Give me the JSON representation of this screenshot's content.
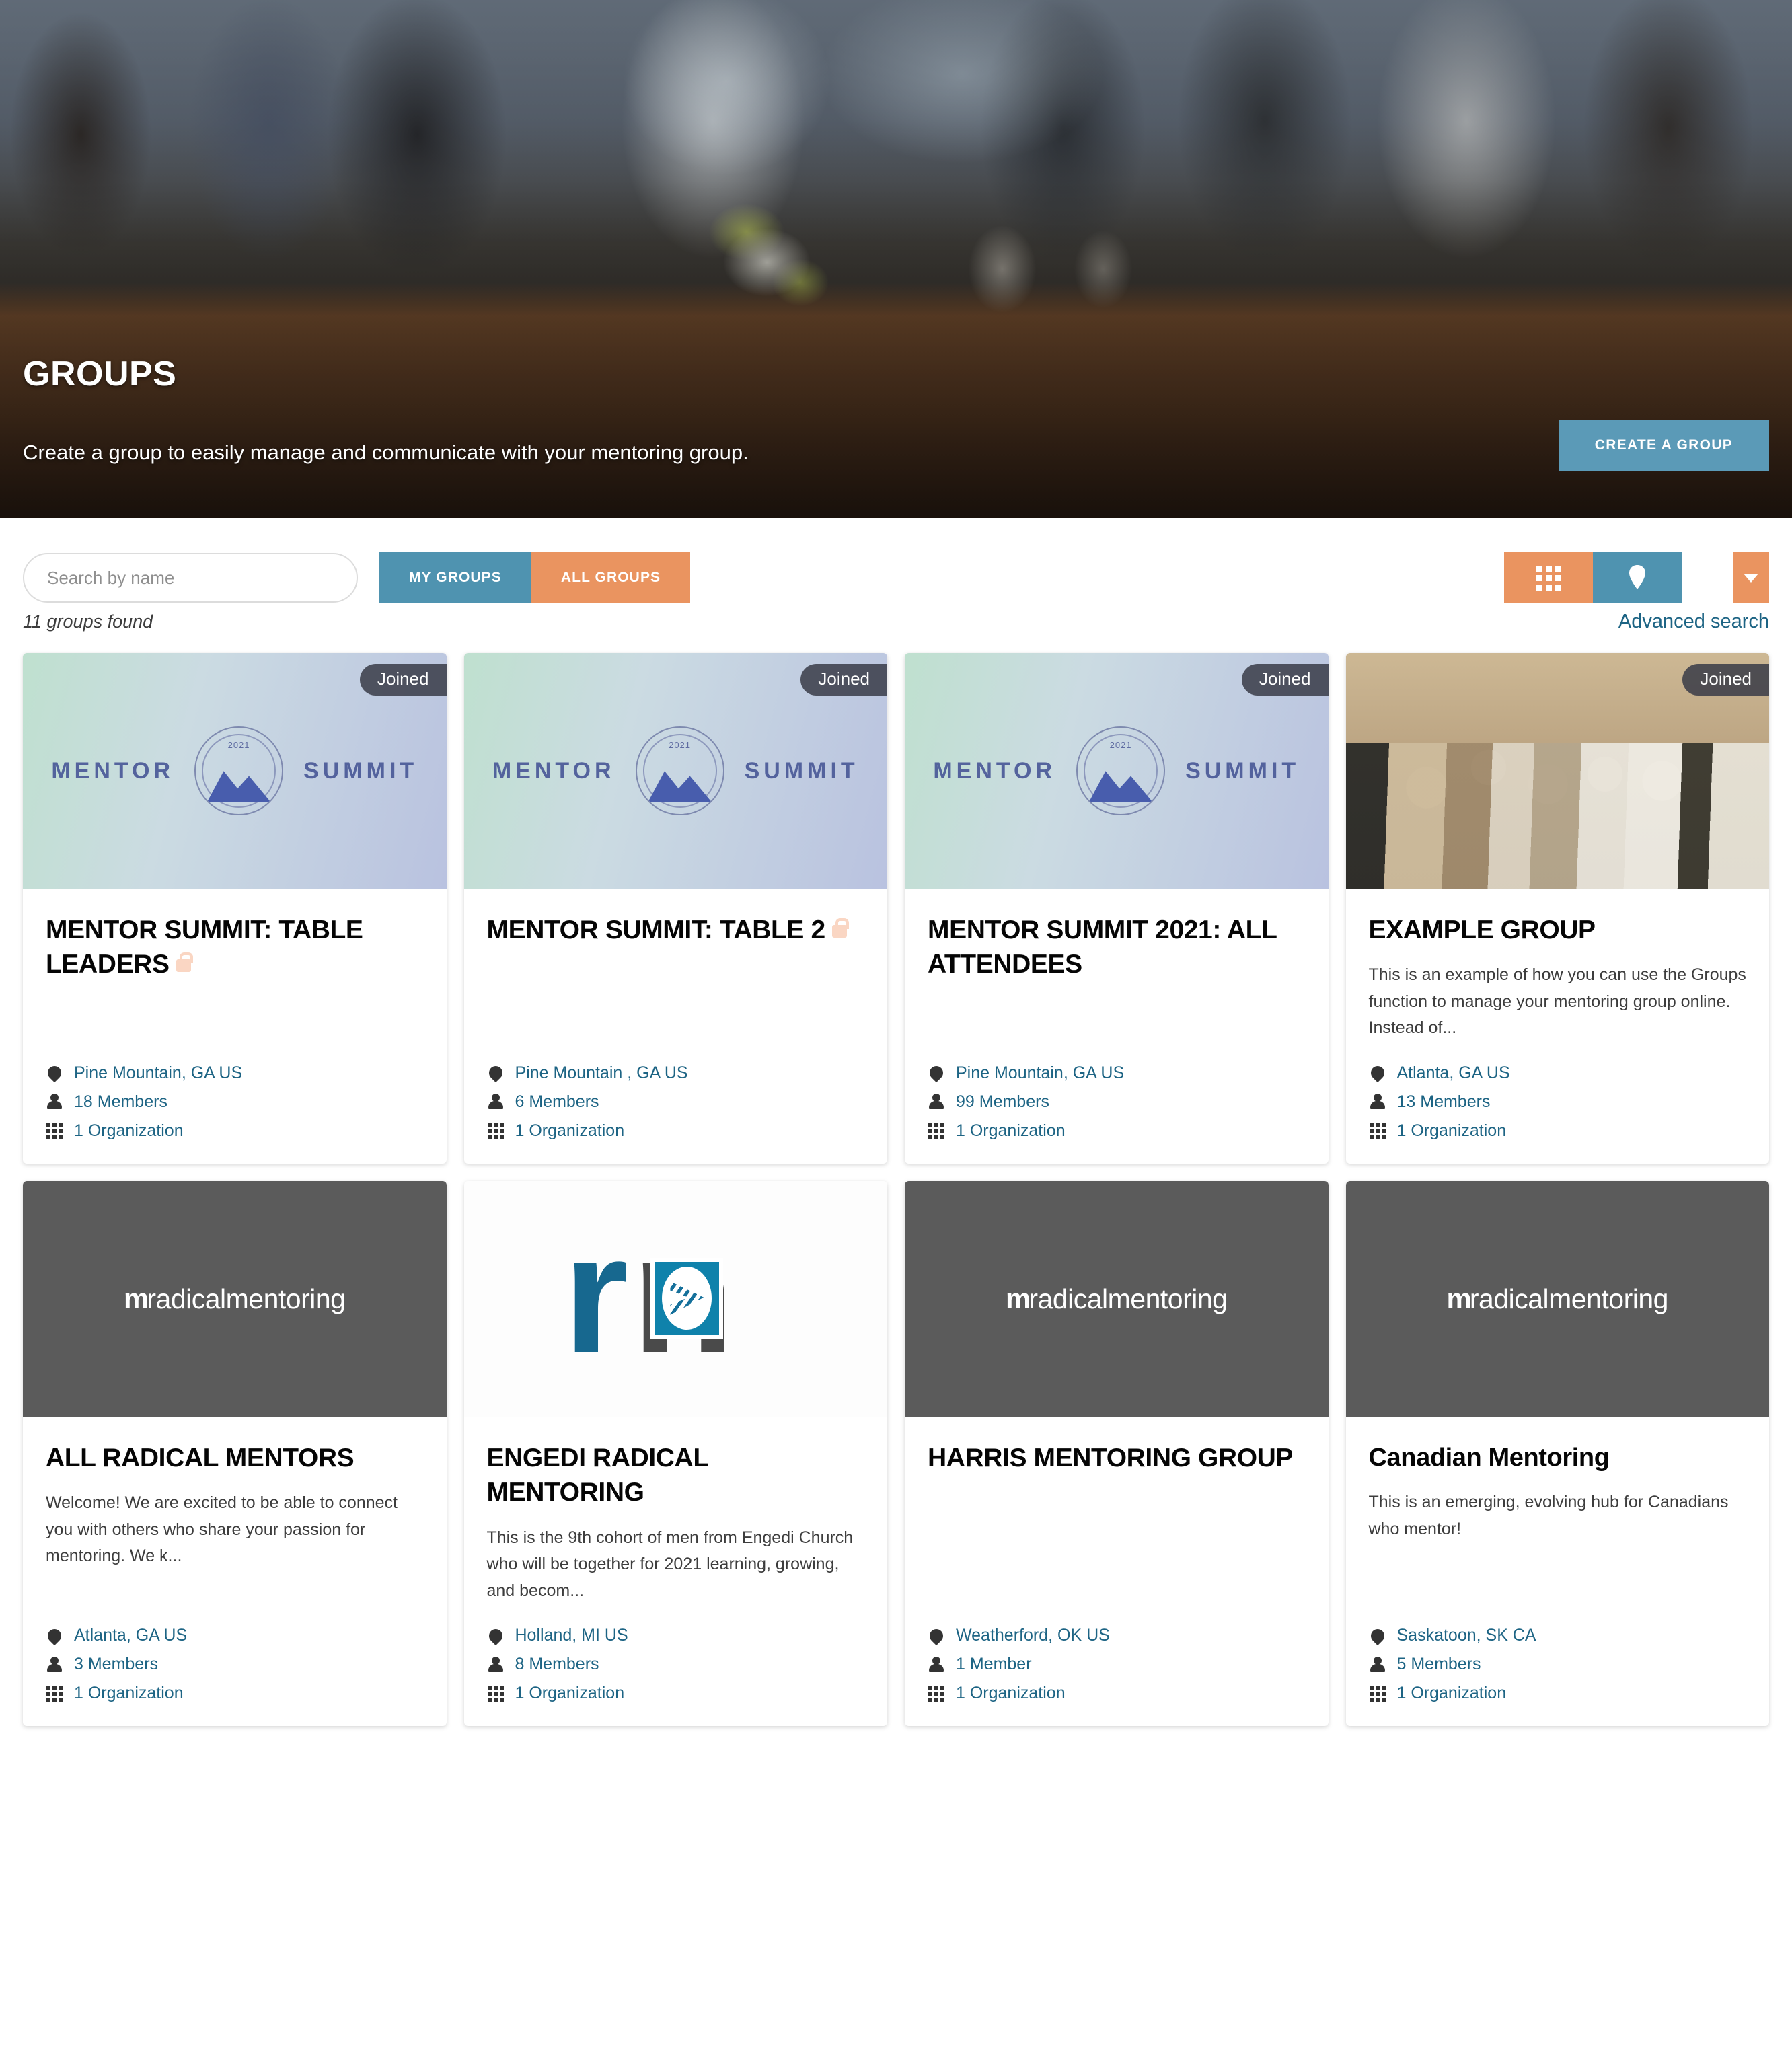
{
  "hero": {
    "title": "GROUPS",
    "subtitle": "Create a group to easily manage and communicate with your mentoring group.",
    "create_button": "CREATE A GROUP"
  },
  "controls": {
    "search_placeholder": "Search by name",
    "search_value": "",
    "tab_my_groups": "MY GROUPS",
    "tab_all_groups": "ALL GROUPS",
    "view_grid_icon": "grid-icon",
    "view_map_icon": "map-pin-icon",
    "sort_caret_icon": "chevron-down-icon"
  },
  "results": {
    "count_label": "11 groups found",
    "advanced_search": "Advanced search"
  },
  "colors": {
    "accent_blue": "#4f93b0",
    "accent_orange": "#ea9460",
    "link_teal": "#1d6484",
    "badge_dark": "#383b47",
    "lock_peach": "#fad6c3"
  },
  "labels": {
    "joined": "Joined",
    "lock_icon": "lock-icon",
    "location_icon": "map-pin-icon",
    "members_icon": "person-icon",
    "organizations_icon": "grid-icon"
  },
  "cards": [
    {
      "title": "MENTOR SUMMIT: TABLE LEADERS",
      "locked": true,
      "joined": true,
      "badge": "Joined",
      "description": "",
      "location": "Pine Mountain, GA US",
      "members": "18 Members",
      "organizations": "1 Organization",
      "media": "summit"
    },
    {
      "title": "MENTOR SUMMIT: TABLE 2",
      "locked": true,
      "joined": true,
      "badge": "Joined",
      "description": "",
      "location": "Pine Mountain , GA US",
      "members": "6 Members",
      "organizations": "1 Organization",
      "media": "summit"
    },
    {
      "title": "MENTOR SUMMIT 2021: ALL ATTENDEES",
      "locked": false,
      "joined": true,
      "badge": "Joined",
      "description": "",
      "location": "Pine Mountain, GA US",
      "members": "99 Members",
      "organizations": "1 Organization",
      "media": "summit"
    },
    {
      "title": "EXAMPLE GROUP",
      "locked": false,
      "joined": true,
      "badge": "Joined",
      "description": "This is an example of how you can use the Groups function to manage your mentoring group online. Instead of...",
      "location": "Atlanta, GA US",
      "members": "13 Members",
      "organizations": "1 Organization",
      "media": "photo"
    },
    {
      "title": "ALL RADICAL MENTORS",
      "locked": false,
      "joined": false,
      "badge": "",
      "description": "Welcome! We are excited to be able to connect you with others who share your passion for mentoring. We k...",
      "location": "Atlanta, GA US",
      "members": "3 Members",
      "organizations": "1 Organization",
      "media": "rm-dark"
    },
    {
      "title": "ENGEDI RADICAL MENTORING",
      "locked": false,
      "joined": false,
      "badge": "",
      "description": "This is the 9th cohort of men from Engedi Church who will be together for 2021 learning, growing, and becom...",
      "location": "Holland, MI US",
      "members": "8 Members",
      "organizations": "1 Organization",
      "media": "engedi"
    },
    {
      "title": "HARRIS MENTORING GROUP",
      "locked": false,
      "joined": false,
      "badge": "",
      "description": "",
      "location": "Weatherford, OK US",
      "members": "1 Member",
      "organizations": "1 Organization",
      "media": "rm-dark"
    },
    {
      "title": "Canadian Mentoring",
      "locked": false,
      "joined": false,
      "badge": "",
      "description": "This is an emerging, evolving hub for Canadians who mentor!",
      "location": "Saskatoon, SK CA",
      "members": "5 Members",
      "organizations": "1 Organization",
      "media": "rm-dark"
    }
  ],
  "brand": {
    "summit_left": "MENTOR",
    "summit_right": "SUMMIT",
    "summit_year": "2021",
    "rm_ligature": "m",
    "rm_wordmark": "radicalmentoring"
  }
}
